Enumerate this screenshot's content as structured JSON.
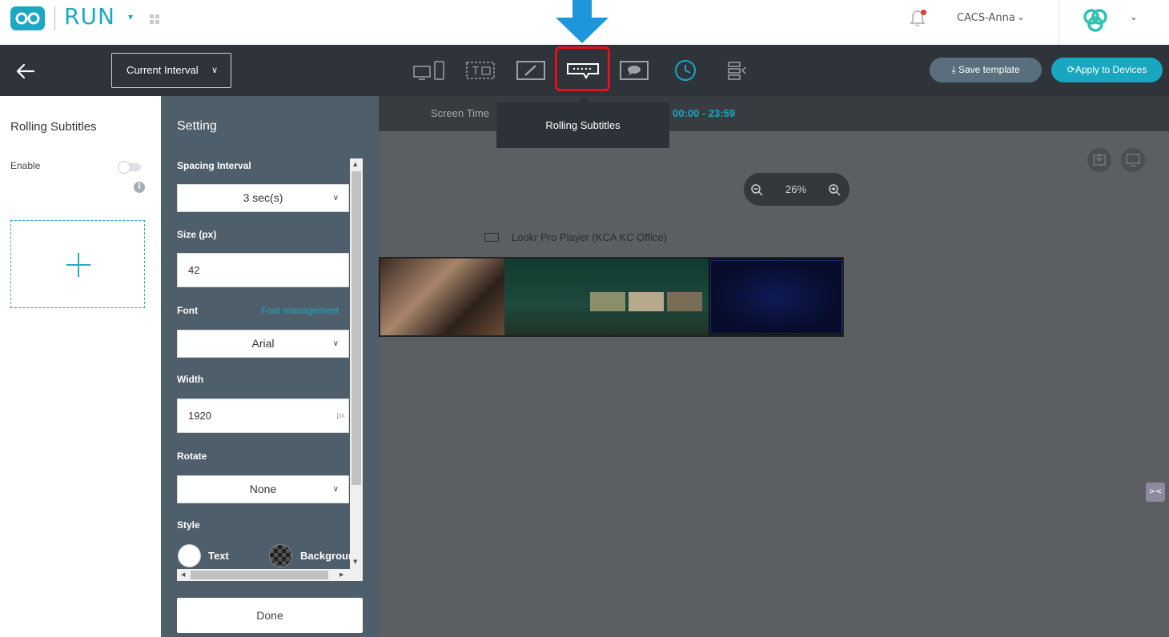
{
  "topbar": {
    "app_name": "RUN",
    "user_name": "CACS-Anna"
  },
  "toolbar": {
    "interval_label": "Current Interval",
    "save_label": "Save template",
    "apply_label": "Apply to Devices",
    "tools": [
      "display-device-icon",
      "text-box-icon",
      "edit-board-icon",
      "rolling-subtitles-icon",
      "message-bubble-icon",
      "clock-icon",
      "align-tool-icon"
    ],
    "active_tool": "rolling-subtitles-icon"
  },
  "tooltip": {
    "text": "Rolling Subtitles"
  },
  "left_panel": {
    "title": "Rolling Subtitles",
    "enable_label": "Enable",
    "enable_on": false
  },
  "setting": {
    "title": "Setting",
    "spacing_interval_label": "Spacing Interval",
    "spacing_interval_value": "3 sec(s)",
    "size_label": "Size (px)",
    "size_value": "42",
    "font_label": "Font",
    "font_management_link": "Font management",
    "font_value": "Arial",
    "width_label": "Width",
    "width_value": "1920",
    "width_unit": "px",
    "rotate_label": "Rotate",
    "rotate_value": "None",
    "style_label": "Style",
    "style_text_label": "Text",
    "style_background_label": "Background",
    "done_label": "Done"
  },
  "canvas": {
    "screen_time_label": "Screen Time",
    "screen_time_value": "00:00 - 23:59",
    "zoom_value": "26%",
    "player_name": "Lookr Pro Player (KCA KC Office)"
  },
  "colors": {
    "accent": "#1ba9c2",
    "highlight": "#e0121c",
    "toolbar_bg": "#2f343b",
    "setting_bg": "#4e5e6b"
  }
}
